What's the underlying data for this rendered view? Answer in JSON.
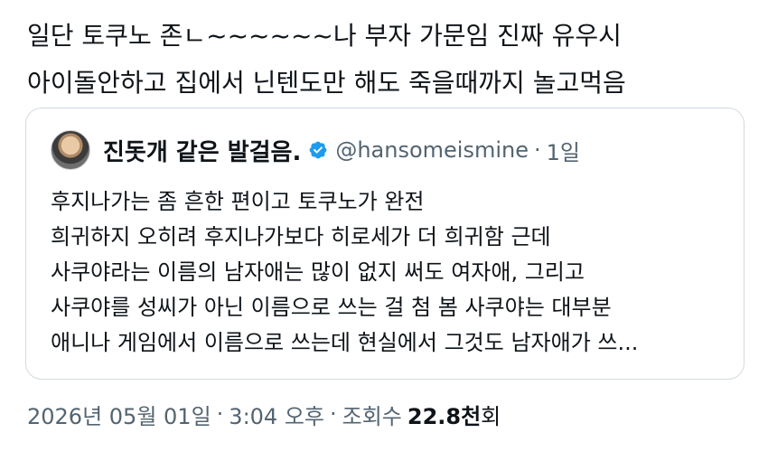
{
  "tweet": {
    "lines": [
      "일단 토쿠노 존ㄴ~~~~~~나 부자 가문임 진짜 유우시",
      "아이돌안하고 집에서 닌텐도만 해도 죽을때까지 놀고먹음"
    ]
  },
  "quote": {
    "author_name": "진돗개 같은 발걸음.",
    "handle": "@hansomeismine",
    "separator": "·",
    "time": "1일",
    "verified_icon": "verified-badge-icon",
    "lines": [
      "후지나가는 좀 흔한 편이고 토쿠노가 완전",
      "희귀하지 오히려 후지나가보다 히로세가 더 희귀함 근데",
      "사쿠야라는 이름의 남자애는 많이 없지 써도 여자애, 그리고",
      "사쿠야를 성씨가 아닌 이름으로 쓰는 걸 첨 봄 사쿠야는 대부분",
      "애니나 게임에서 이름으로 쓰는데 현실에서 그것도 남자애가 쓰..."
    ]
  },
  "meta": {
    "date": "2026년 05월 01일",
    "separator": "·",
    "time": "3:04 오후",
    "views_label": "조회수",
    "views_count": "22.8천",
    "views_suffix": "회"
  },
  "colors": {
    "text": "#0f1419",
    "secondary": "#536471",
    "border": "#d3dadf",
    "verified": "#1d9bf0"
  }
}
